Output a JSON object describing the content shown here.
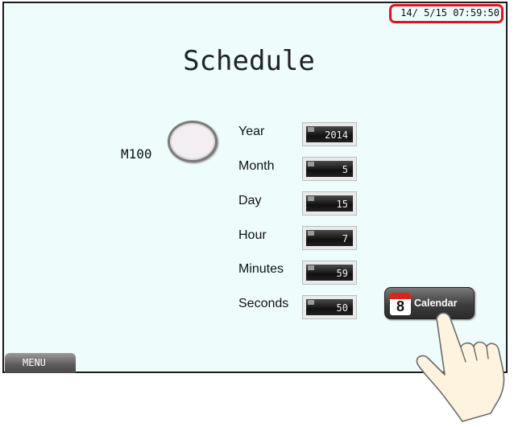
{
  "status": {
    "datetime": "14/ 5/15 07:59:50"
  },
  "title": "Schedule",
  "lamp": {
    "label": "M100"
  },
  "fields": [
    {
      "label": "Year",
      "value": "2014"
    },
    {
      "label": "Month",
      "value": "5"
    },
    {
      "label": "Day",
      "value": "15"
    },
    {
      "label": "Hour",
      "value": "7"
    },
    {
      "label": "Minutes",
      "value": "59"
    },
    {
      "label": "Seconds",
      "value": "50"
    }
  ],
  "calendar_button": {
    "label": "Calendar",
    "icon": "calendar-icon",
    "icon_number": "8"
  },
  "menu_button": {
    "label": "MENU"
  },
  "hand": {
    "icon": "pointing-hand-icon"
  },
  "colors": {
    "highlight": "#e8101e",
    "background": "#eefcfc",
    "calendar_red": "#d9261c"
  }
}
